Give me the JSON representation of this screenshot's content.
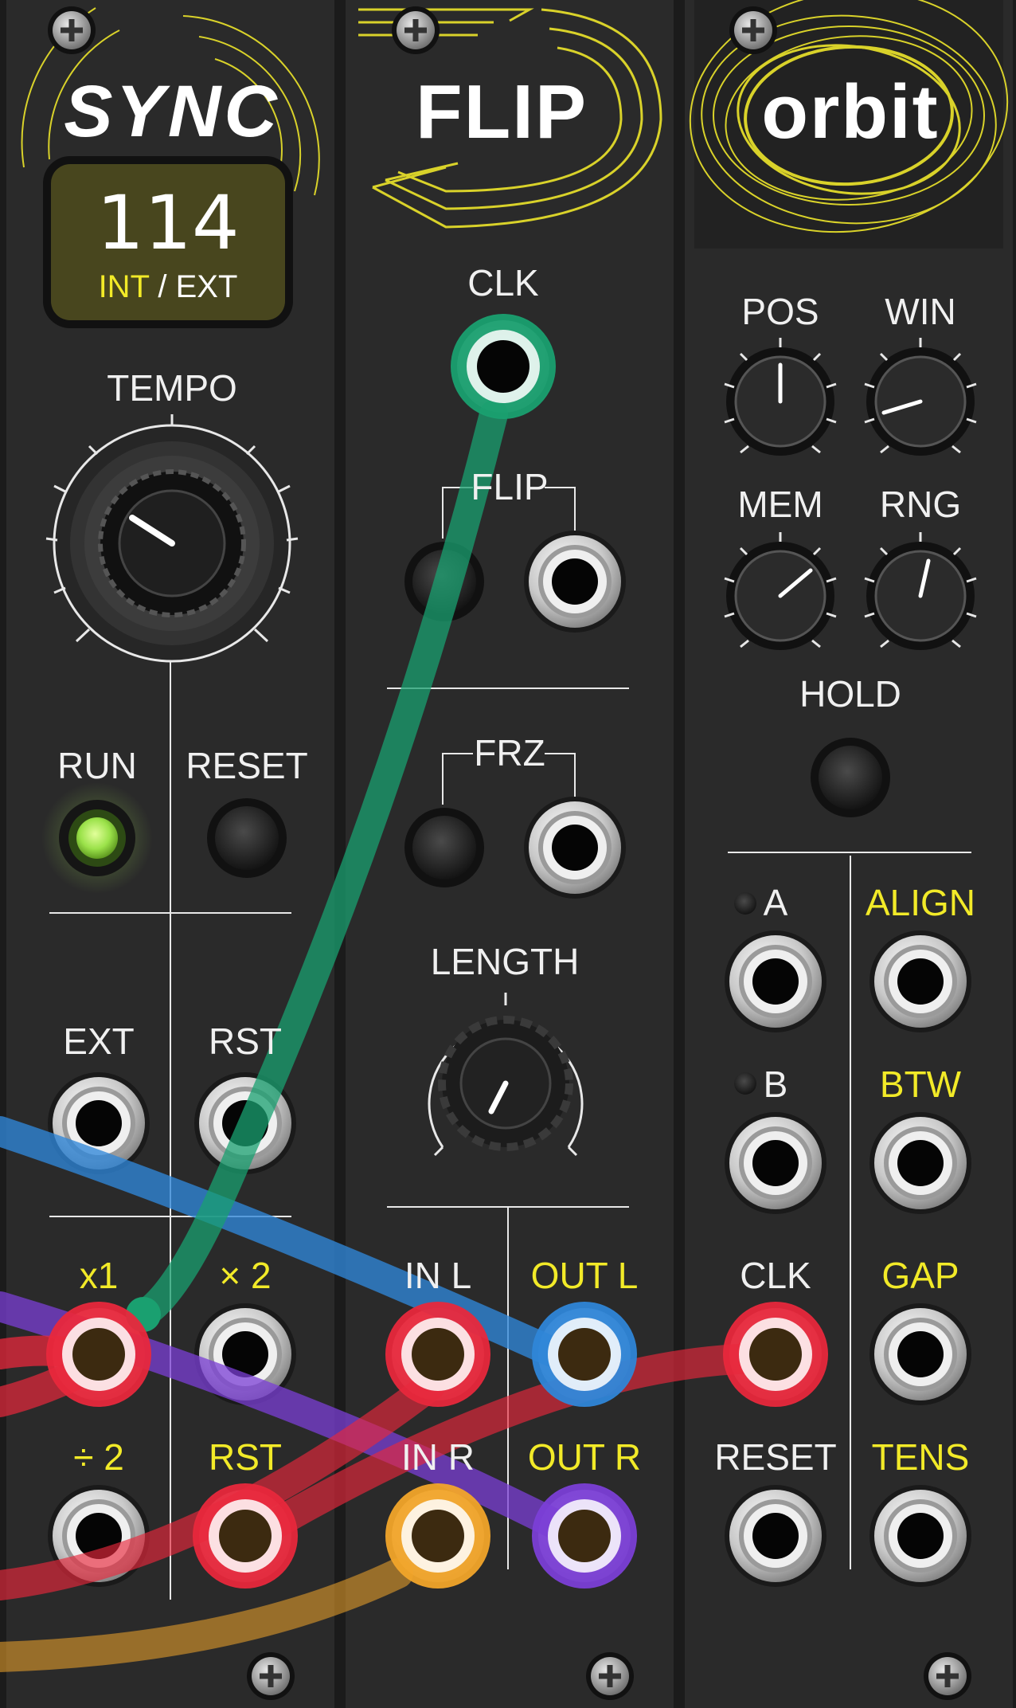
{
  "modules": [
    {
      "id": "sync",
      "title": "SYNC",
      "display": {
        "value": "114",
        "mode_int": "INT",
        "mode_sep": " / ",
        "mode_ext": "EXT"
      },
      "labels": {
        "tempo": "TEMPO",
        "run": "RUN",
        "reset": "RESET",
        "ext": "EXT",
        "rst": "RST",
        "x1": "x1",
        "x2": "× 2",
        "div2": "÷ 2",
        "rst_out": "RST"
      }
    },
    {
      "id": "flip",
      "title": "FLIP",
      "labels": {
        "clk": "CLK",
        "flip": "FLIP",
        "frz": "FRZ",
        "length": "LENGTH",
        "in_l": "IN L",
        "out_l": "OUT L",
        "in_r": "IN R",
        "out_r": "OUT R"
      }
    },
    {
      "id": "orbit",
      "title": "orbit",
      "labels": {
        "pos": "POS",
        "win": "WIN",
        "mem": "MEM",
        "rng": "RNG",
        "hold": "HOLD",
        "a": "A",
        "b": "B",
        "clk": "CLK",
        "reset": "RESET",
        "align": "ALIGN",
        "btw": "BTW",
        "gap": "GAP",
        "tens": "TENS"
      }
    }
  ],
  "colors": {
    "panel": "#2a2a2a",
    "accent_yellow": "#f2ea28",
    "cable_green": "#1aa070",
    "cable_red": "#e8283c",
    "cable_blue": "#2f86d8",
    "cable_orange": "#f2a52a",
    "cable_purple": "#7b3fd6",
    "led_green": "#9be24a"
  },
  "indicators": {
    "run_led": "on",
    "a_led": "off",
    "b_led": "off"
  }
}
